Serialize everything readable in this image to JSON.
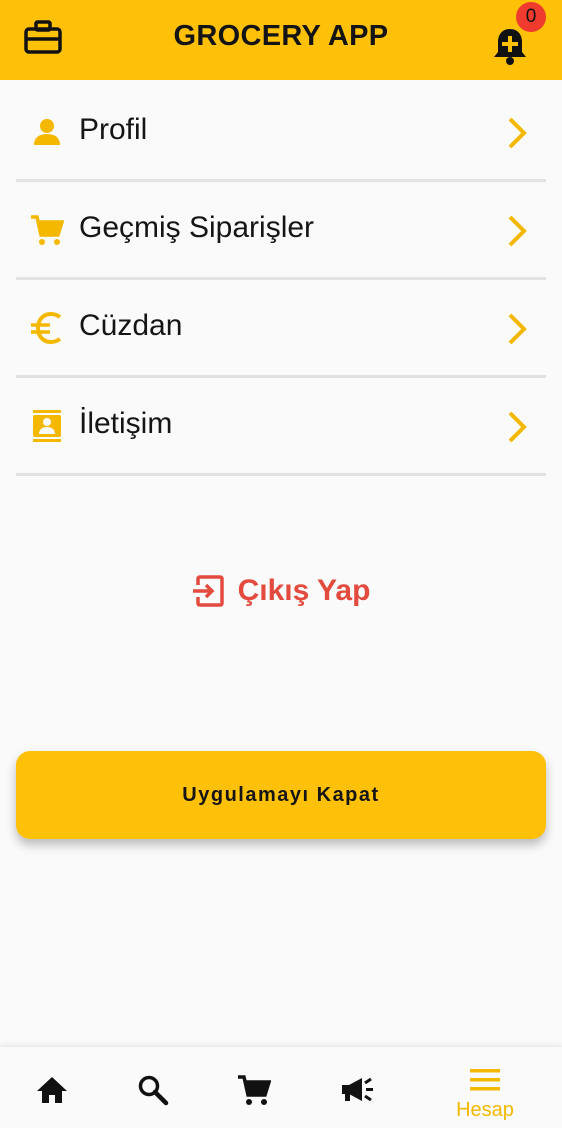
{
  "app_bar": {
    "title": "GROCERY APP",
    "left_icon": "briefcase-icon",
    "notification_icon": "bell-plus-icon",
    "notification_count": "0"
  },
  "menu": {
    "items": [
      {
        "label": "Profil",
        "icon": "person-icon"
      },
      {
        "label": "Geçmiş Siparişler",
        "icon": "cart-icon"
      },
      {
        "label": "Cüzdan",
        "icon": "euro-icon"
      },
      {
        "label": "İletişim",
        "icon": "contact-icon"
      }
    ],
    "chevron_icon": "chevron-right-icon"
  },
  "logout": {
    "label": "Çıkış Yap",
    "icon": "exit-icon"
  },
  "close_button": {
    "label": "Uygulamayı Kapat"
  },
  "bottom_nav": {
    "items": [
      {
        "icon": "home-icon"
      },
      {
        "icon": "search-icon"
      },
      {
        "icon": "cart-icon"
      },
      {
        "icon": "megaphone-icon"
      },
      {
        "icon": "menu-icon",
        "label": "Hesap",
        "active": true
      }
    ]
  },
  "colors": {
    "accent": "#fec107",
    "danger": "#e34b3f",
    "badge": "#ef3b2d",
    "background": "#fafafa"
  }
}
